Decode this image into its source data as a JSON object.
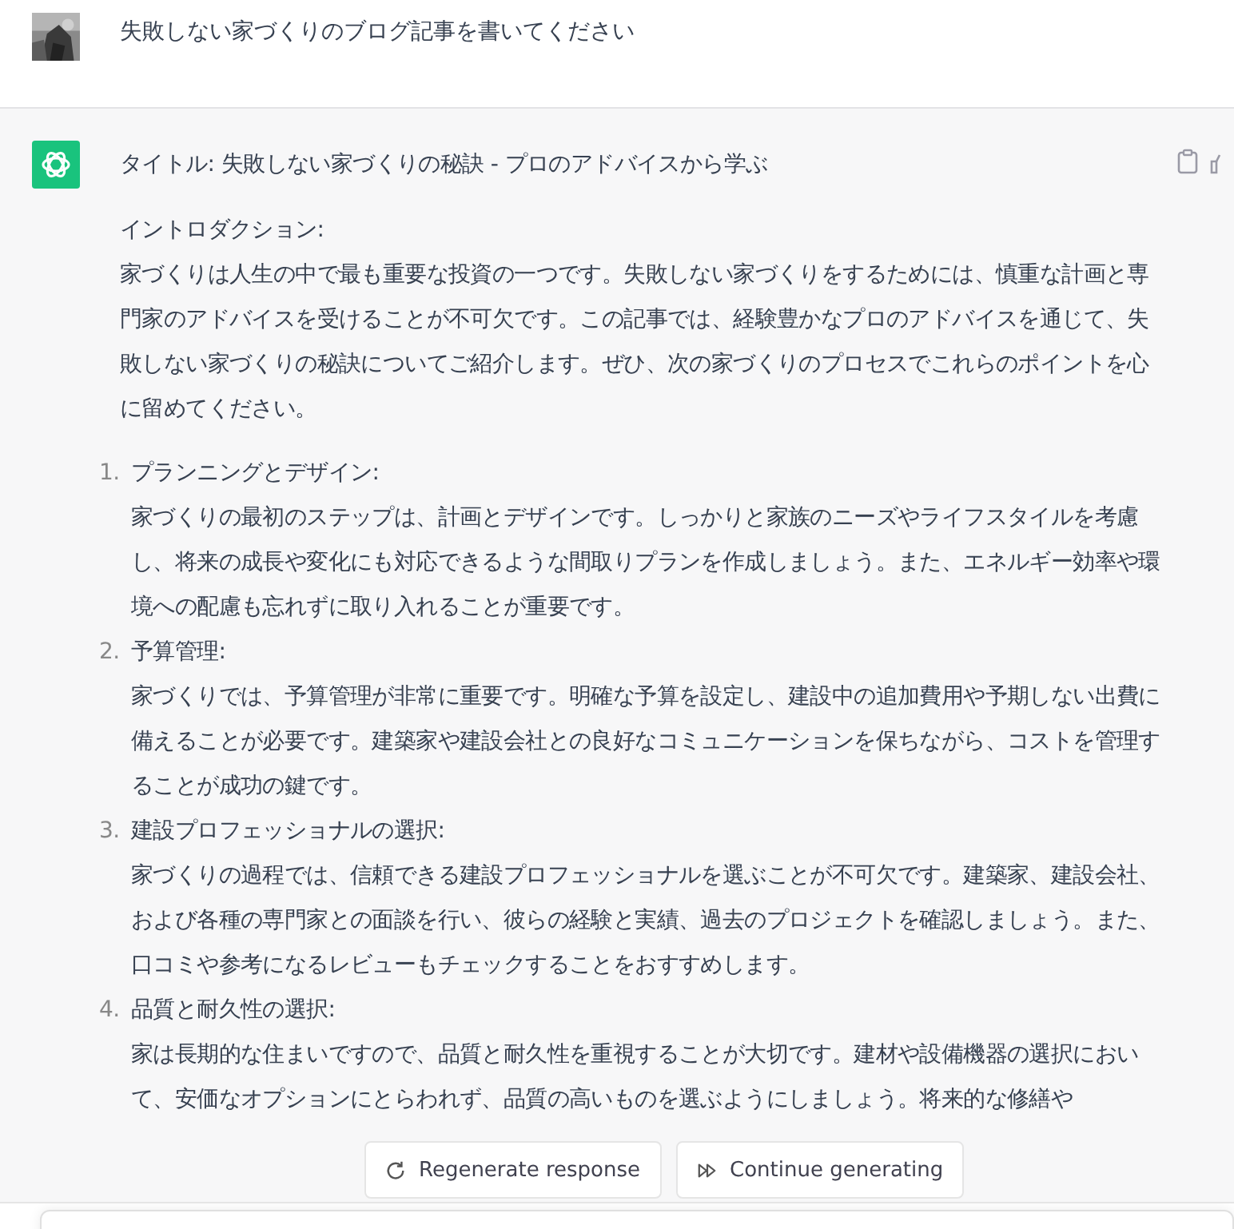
{
  "user_message": {
    "text": "失敗しない家づくりのブログ記事を書いてください"
  },
  "assistant_message": {
    "title": "タイトル: 失敗しない家づくりの秘訣 - プロのアドバイスから学ぶ",
    "intro_heading": "イントロダクション:",
    "intro": "家づくりは人生の中で最も重要な投資の一つです。失敗しない家づくりをするためには、慎重な計画と専門家のアドバイスを受けることが不可欠です。この記事では、経験豊かなプロのアドバイスを通じて、失敗しない家づくりの秘訣についてご紹介します。ぜひ、次の家づくりのプロセスでこれらのポイントを心に留めてください。",
    "items": [
      {
        "number": "1.",
        "heading": "プランニングとデザイン:",
        "body": "家づくりの最初のステップは、計画とデザインです。しっかりと家族のニーズやライフスタイルを考慮し、将来の成長や変化にも対応できるような間取りプランを作成しましょう。また、エネルギー効率や環境への配慮も忘れずに取り入れることが重要です。"
      },
      {
        "number": "2.",
        "heading": "予算管理:",
        "body": "家づくりでは、予算管理が非常に重要です。明確な予算を設定し、建設中の追加費用や予期しない出費に備えることが必要です。建築家や建設会社との良好なコミュニケーションを保ちながら、コストを管理することが成功の鍵です。"
      },
      {
        "number": "3.",
        "heading": "建設プロフェッショナルの選択:",
        "body": "家づくりの過程では、信頼できる建設プロフェッショナルを選ぶことが不可欠です。建築家、建設会社、および各種の専門家との面談を行い、彼らの経験と実績、過去のプロジェクトを確認しましょう。また、口コミや参考になるレビューもチェックすることをおすすめします。"
      },
      {
        "number": "4.",
        "heading": "品質と耐久性の選択:",
        "body": "家は長期的な住まいですので、品質と耐久性を重視することが大切です。建材や設備機器の選択において、安価なオプションにとらわれず、品質の高いものを選ぶようにしましょう。将来的な修繕や"
      }
    ]
  },
  "buttons": [
    {
      "kind": "regenerate",
      "label": "Regenerate response"
    },
    {
      "kind": "continue",
      "label": "Continue generating"
    }
  ]
}
